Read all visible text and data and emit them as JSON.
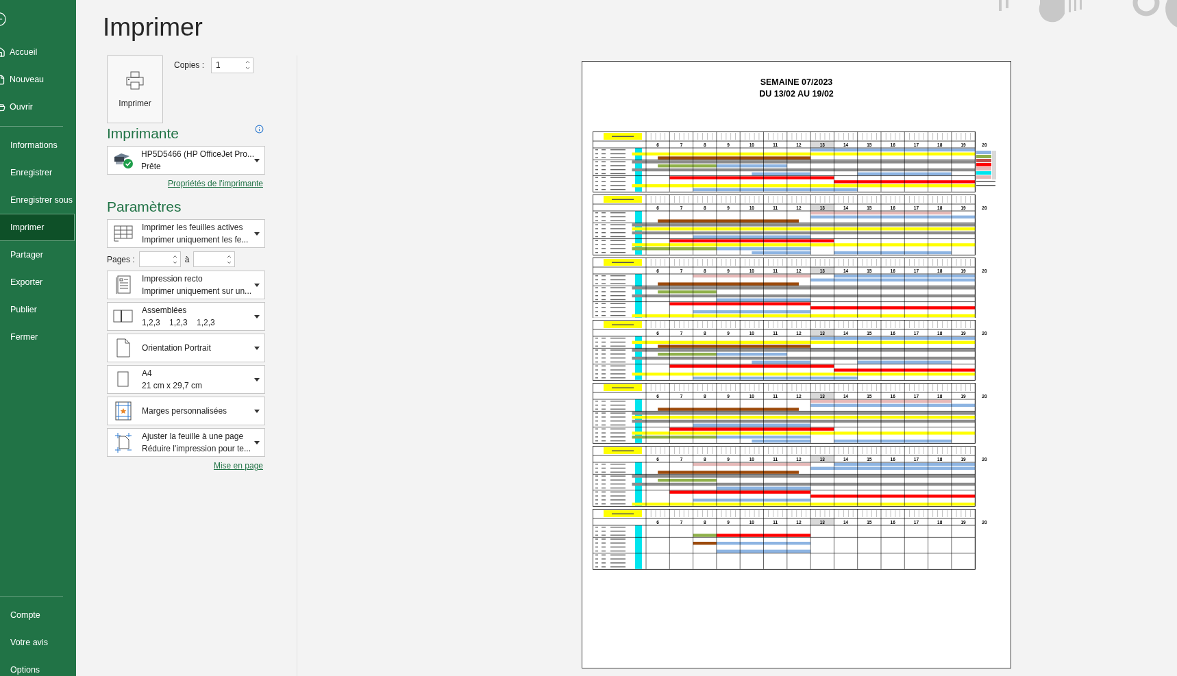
{
  "sidebar": {
    "items": [
      {
        "label": "Accueil",
        "selected": false
      },
      {
        "label": "Nouveau",
        "selected": false
      },
      {
        "label": "Ouvrir",
        "selected": false
      },
      {
        "kind": "separator"
      },
      {
        "label": "Informations",
        "selected": false
      },
      {
        "label": "Enregistrer",
        "selected": false
      },
      {
        "label": "Enregistrer sous",
        "selected": false
      },
      {
        "label": "Imprimer",
        "selected": true
      },
      {
        "label": "Partager",
        "selected": false
      },
      {
        "label": "Exporter",
        "selected": false
      },
      {
        "label": "Publier",
        "selected": false
      },
      {
        "label": "Fermer",
        "selected": false
      }
    ],
    "bottom_items": [
      {
        "label": "Compte",
        "selected": false
      },
      {
        "label": "Votre avis",
        "selected": false
      },
      {
        "label": "Options",
        "selected": false
      }
    ]
  },
  "page_title": "Imprimer",
  "print_button": {
    "label": "Imprimer"
  },
  "copies": {
    "label": "Copies :",
    "value": "1"
  },
  "printer": {
    "heading": "Imprimante",
    "name": "HP5D5466 (HP OfficeJet Pro...",
    "status": "Prête",
    "link": "Propriétés de l'imprimante"
  },
  "settings": {
    "heading": "Paramètres",
    "items": [
      {
        "kind": "dropdown",
        "title": "Imprimer les feuilles actives",
        "subtitle": "Imprimer uniquement les fe..."
      },
      {
        "kind": "pages",
        "label": "Pages :",
        "separator": "à"
      },
      {
        "kind": "dropdown",
        "title": "Impression recto",
        "subtitle": "Imprimer uniquement sur un..."
      },
      {
        "kind": "dropdown",
        "title": "Assemblées",
        "subtitle": "1,2,3    1,2,3    1,2,3"
      },
      {
        "kind": "dropdown",
        "title": "Orientation Portrait"
      },
      {
        "kind": "dropdown",
        "title": "A4",
        "subtitle": "21 cm x 29,7 cm"
      },
      {
        "kind": "dropdown",
        "title": "Marges personnalisées"
      },
      {
        "kind": "dropdown",
        "title": "Ajuster la feuille à une page",
        "subtitle": "Réduire l'impression pour te..."
      }
    ],
    "link": "Mise en page"
  },
  "preview": {
    "title_lines": [
      "SEMAINE 07/2023",
      "DU 13/02 AU 19/02"
    ],
    "days": [
      {
        "hours": [
          "6",
          "7",
          "8",
          "9",
          "10",
          "11",
          "12",
          "13",
          "14",
          "15",
          "16",
          "17",
          "18",
          "19"
        ],
        "after": "20"
      },
      {
        "hours": [
          "6",
          "7",
          "8",
          "9",
          "10",
          "11",
          "12",
          "13",
          "14",
          "15",
          "16",
          "17",
          "18",
          "19"
        ],
        "after": "20"
      },
      {
        "hours": [
          "6",
          "7",
          "8",
          "9",
          "10",
          "11",
          "12",
          "13",
          "14",
          "15",
          "16",
          "17",
          "18",
          "19"
        ],
        "after": "20"
      },
      {
        "hours": [
          "6",
          "7",
          "8",
          "9",
          "10",
          "11",
          "12",
          "13",
          "14",
          "15",
          "16",
          "17",
          "18",
          "19"
        ],
        "after": "20"
      },
      {
        "hours": [
          "6",
          "7",
          "8",
          "9",
          "10",
          "11",
          "12",
          "13",
          "14",
          "15",
          "16",
          "17",
          "18",
          "19"
        ],
        "after": "20"
      },
      {
        "hours": [
          "6",
          "7",
          "8",
          "9",
          "10",
          "11",
          "12",
          "13",
          "14",
          "15",
          "16",
          "17",
          "18",
          "19"
        ],
        "after": "20"
      },
      {
        "hours": [
          "6",
          "7",
          "8",
          "9",
          "10",
          "11",
          "12",
          "13",
          "14",
          "15",
          "16",
          "17",
          "18",
          "19"
        ],
        "after": "20"
      }
    ]
  }
}
